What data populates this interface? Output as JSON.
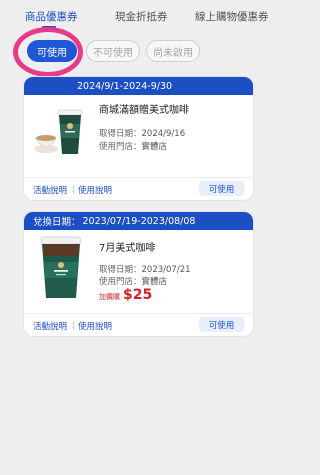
{
  "tabs": [
    {
      "label": "商品優惠券"
    },
    {
      "label": "現金折抵券"
    },
    {
      "label": "線上購物優惠券"
    }
  ],
  "filters": [
    {
      "label": "可使用"
    },
    {
      "label": "不可使用"
    },
    {
      "label": "尚未啟用"
    }
  ],
  "coupons": [
    {
      "period": "2024/9/1-2024-9/30",
      "period_prefix": "",
      "title": "商城滿額贈美式咖啡",
      "acquired_label": "取得日期：",
      "acquired": "2024/9/16",
      "store_label": "使用門店：",
      "store": "實體店",
      "link_info": "活動說明",
      "link_guide": "使用說明",
      "button": "可使用"
    },
    {
      "period": "2023/07/19-2023/08/08",
      "period_prefix": "兌換日期：",
      "title": "7月美式咖啡",
      "acquired_label": "取得日期：",
      "acquired": "2023/07/21",
      "store_label": "使用門店：",
      "store": "實體店",
      "promo_tag": "加價購",
      "promo_price": "$25",
      "link_info": "活動說明",
      "link_guide": "使用說明",
      "button": "可使用"
    }
  ],
  "colors": {
    "primary": "#1d4fc4",
    "highlight": "#e63b8a",
    "price": "#d01f2a"
  },
  "icons": [
    "coffee-cup-hot-icon",
    "coffee-cup-iced-icon"
  ]
}
